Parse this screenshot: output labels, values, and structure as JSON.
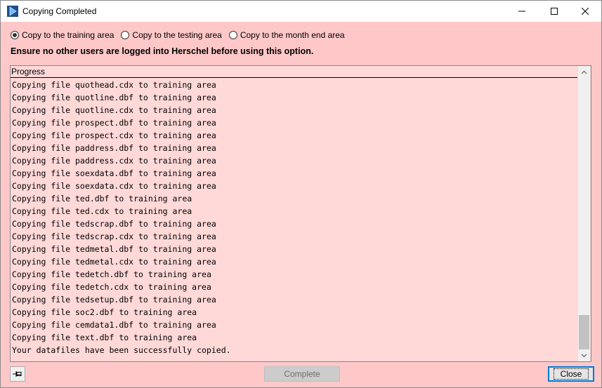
{
  "window": {
    "title": "Copying Completed",
    "icons": {
      "app": "play-icon",
      "minimize": "minimize-icon",
      "maximize": "maximize-icon",
      "close": "close-icon"
    }
  },
  "options": {
    "training": {
      "label": "Copy to the training area",
      "selected": true
    },
    "testing": {
      "label": "Copy to the testing area",
      "selected": false
    },
    "month_end": {
      "label": "Copy to the month end area",
      "selected": false
    }
  },
  "warning": "Ensure no other users are logged into Herschel before using this option.",
  "progress": {
    "header": "Progress",
    "lines": [
      "Copying file quothead.cdx to training area",
      "Copying file quotline.dbf to training area",
      "Copying file quotline.cdx to training area",
      "Copying file prospect.dbf to training area",
      "Copying file prospect.cdx to training area",
      "Copying file paddress.dbf to training area",
      "Copying file paddress.cdx to training area",
      "Copying file soexdata.dbf to training area",
      "Copying file soexdata.cdx to training area",
      "Copying file ted.dbf to training area",
      "Copying file ted.cdx to training area",
      "Copying file tedscrap.dbf to training area",
      "Copying file tedscrap.cdx to training area",
      "Copying file tedmetal.dbf to training area",
      "Copying file tedmetal.cdx to training area",
      "Copying file tedetch.dbf to training area",
      "Copying file tedetch.cdx to training area",
      "Copying file tedsetup.dbf to training area",
      "Copying file soc2.dbf to training area",
      "Copying file cemdata1.dbf to training area",
      "Copying file text.dbf to training area",
      "Your datafiles have been successfully copied."
    ]
  },
  "buttons": {
    "pin_icon": "pin-icon",
    "complete": {
      "label": "Complete",
      "enabled": false
    },
    "close": {
      "label": "Close"
    }
  },
  "colors": {
    "background": "#ffc8c8",
    "list_background": "#ffd8d8",
    "focus_border": "#0078d7",
    "app_icon": "#1f4e8c"
  }
}
